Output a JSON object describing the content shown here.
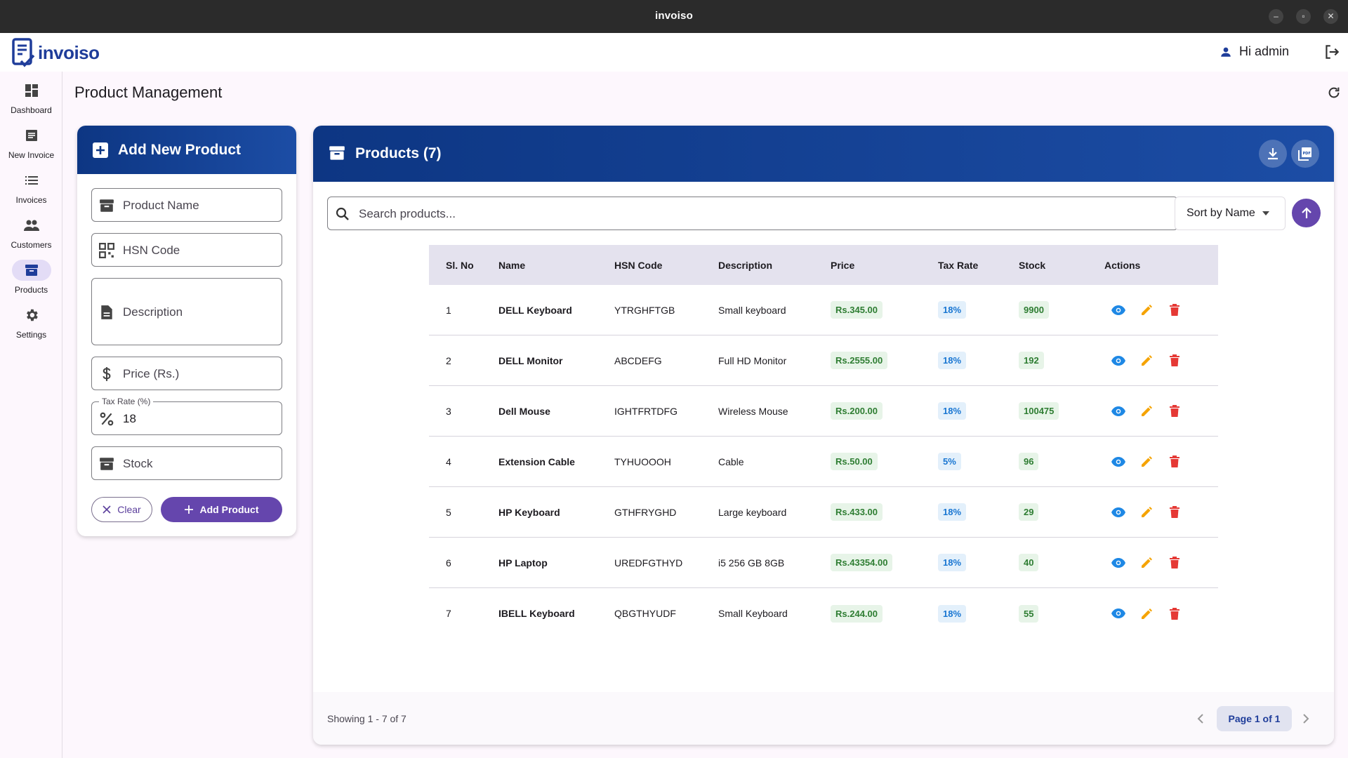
{
  "window": {
    "title": "invoiso"
  },
  "app": {
    "logo_text": "invoiso",
    "user_greeting": "Hi admin"
  },
  "sidebar": {
    "items": [
      {
        "label": "Dashboard",
        "icon": "dashboard-icon"
      },
      {
        "label": "New Invoice",
        "icon": "new-invoice-icon"
      },
      {
        "label": "Invoices",
        "icon": "list-icon"
      },
      {
        "label": "Customers",
        "icon": "people-icon"
      },
      {
        "label": "Products",
        "icon": "inventory-icon",
        "active": true
      },
      {
        "label": "Settings",
        "icon": "gear-icon"
      }
    ]
  },
  "page": {
    "title": "Product Management"
  },
  "add_form": {
    "title": "Add New Product",
    "product_name_placeholder": "Product Name",
    "hsn_placeholder": "HSN Code",
    "description_placeholder": "Description",
    "price_placeholder": "Price (Rs.)",
    "tax_label": "Tax Rate (%)",
    "tax_value": "18",
    "stock_placeholder": "Stock",
    "clear_label": "Clear",
    "add_label": "Add Product"
  },
  "products": {
    "title": "Products (7)",
    "search_placeholder": "Search products...",
    "sort_label": "Sort by Name",
    "columns": [
      "Sl. No",
      "Name",
      "HSN Code",
      "Description",
      "Price",
      "Tax Rate",
      "Stock",
      "Actions"
    ],
    "rows": [
      {
        "sl": "1",
        "name": "DELL Keyboard",
        "hsn": "YTRGHFTGB",
        "desc": "Small keyboard",
        "price": "Rs.345.00",
        "tax": "18%",
        "stock": "9900"
      },
      {
        "sl": "2",
        "name": "DELL Monitor",
        "hsn": "ABCDEFG",
        "desc": "Full HD Monitor",
        "price": "Rs.2555.00",
        "tax": "18%",
        "stock": "192"
      },
      {
        "sl": "3",
        "name": "Dell Mouse",
        "hsn": "IGHTFRTDFG",
        "desc": "Wireless Mouse",
        "price": "Rs.200.00",
        "tax": "18%",
        "stock": "100475"
      },
      {
        "sl": "4",
        "name": "Extension Cable",
        "hsn": "TYHUOOOH",
        "desc": "Cable",
        "price": "Rs.50.00",
        "tax": "5%",
        "stock": "96"
      },
      {
        "sl": "5",
        "name": "HP Keyboard",
        "hsn": "GTHFRYGHD",
        "desc": "Large keyboard",
        "price": "Rs.433.00",
        "tax": "18%",
        "stock": "29"
      },
      {
        "sl": "6",
        "name": "HP Laptop",
        "hsn": "UREDFGTHYD",
        "desc": "i5 256 GB 8GB",
        "price": "Rs.43354.00",
        "tax": "18%",
        "stock": "40"
      },
      {
        "sl": "7",
        "name": "IBELL Keyboard",
        "hsn": "QBGTHYUDF",
        "desc": "Small Keyboard",
        "price": "Rs.244.00",
        "tax": "18%",
        "stock": "55"
      }
    ],
    "showing": "Showing 1 - 7 of 7",
    "page_label": "Page 1 of 1"
  },
  "colors": {
    "header_blue": "#0d3683",
    "accent_purple": "#6546ad",
    "price_green": "#2e7d32",
    "tax_blue": "#1976d2",
    "delete_red": "#e53935",
    "edit_orange": "#f5a300",
    "view_blue": "#1e88e5"
  }
}
